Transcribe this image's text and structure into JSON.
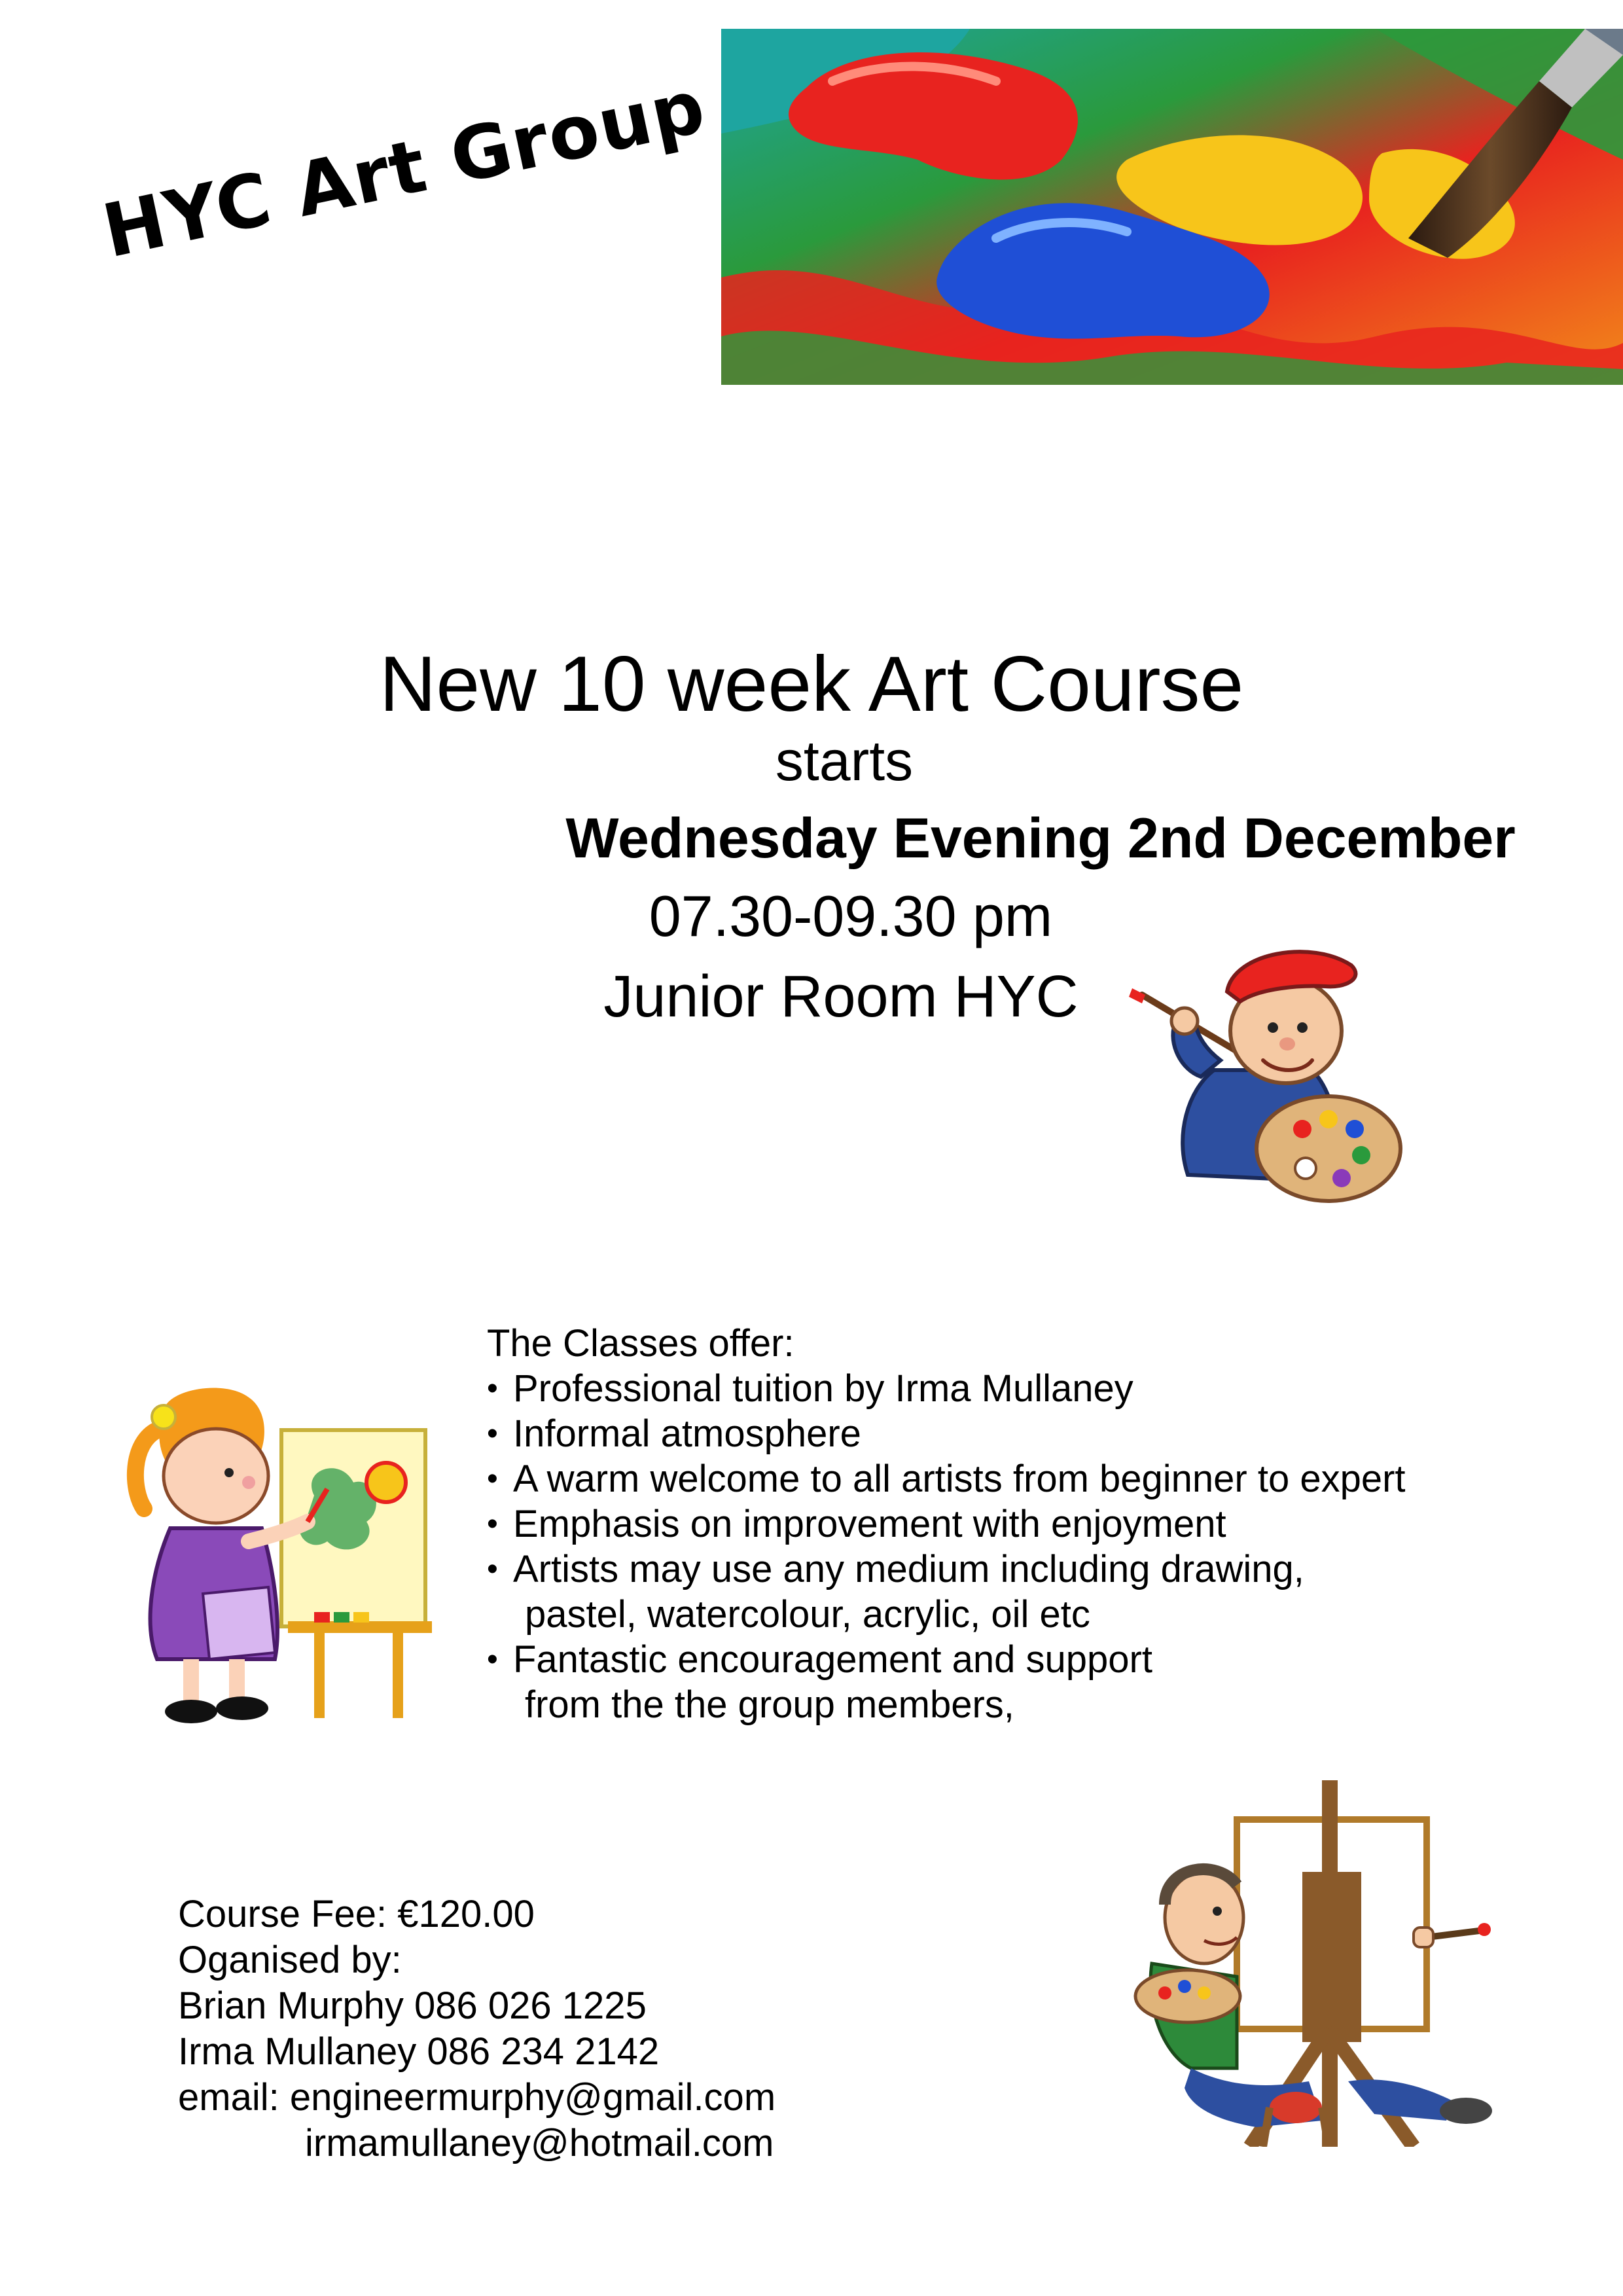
{
  "logo": {
    "text": "HYC Art Group"
  },
  "hero": {
    "icon": "paint-brush-and-paint-blobs-photo"
  },
  "headline": {
    "title": "New 10 week Art Course",
    "starts": "starts",
    "date": "Wednesday Evening 2nd December",
    "time": "07.30-09.30 pm",
    "location": "Junior Room HYC"
  },
  "classes": {
    "heading": "The Classes offer:",
    "items": [
      {
        "text": "Professional tuition by Irma Mullaney"
      },
      {
        "text": "Informal atmosphere"
      },
      {
        "text": "A warm welcome to all artists from beginner to expert"
      },
      {
        "text": "Emphasis on improvement with enjoyment"
      },
      {
        "text": "Artists may use any medium including drawing,",
        "cont": "pastel, watercolour, acrylic, oil etc"
      },
      {
        "text": "Fantastic encouragement and support",
        "cont": "from the the group members,"
      }
    ]
  },
  "contact": {
    "fee": "Course Fee: €120.00",
    "organised": "Oganised by:",
    "person1": "Brian Murphy 086 026 1225",
    "person2": "Irma Mullaney 086 234 2142",
    "email1": "email: engineermurphy@gmail.com",
    "email2": "irmamullaney@hotmail.com"
  },
  "colors": {
    "red": "#e8231f",
    "yellow": "#f7c51a",
    "blue": "#1f4fd6",
    "green": "#2a9a3c",
    "teal": "#1ea5a0"
  }
}
